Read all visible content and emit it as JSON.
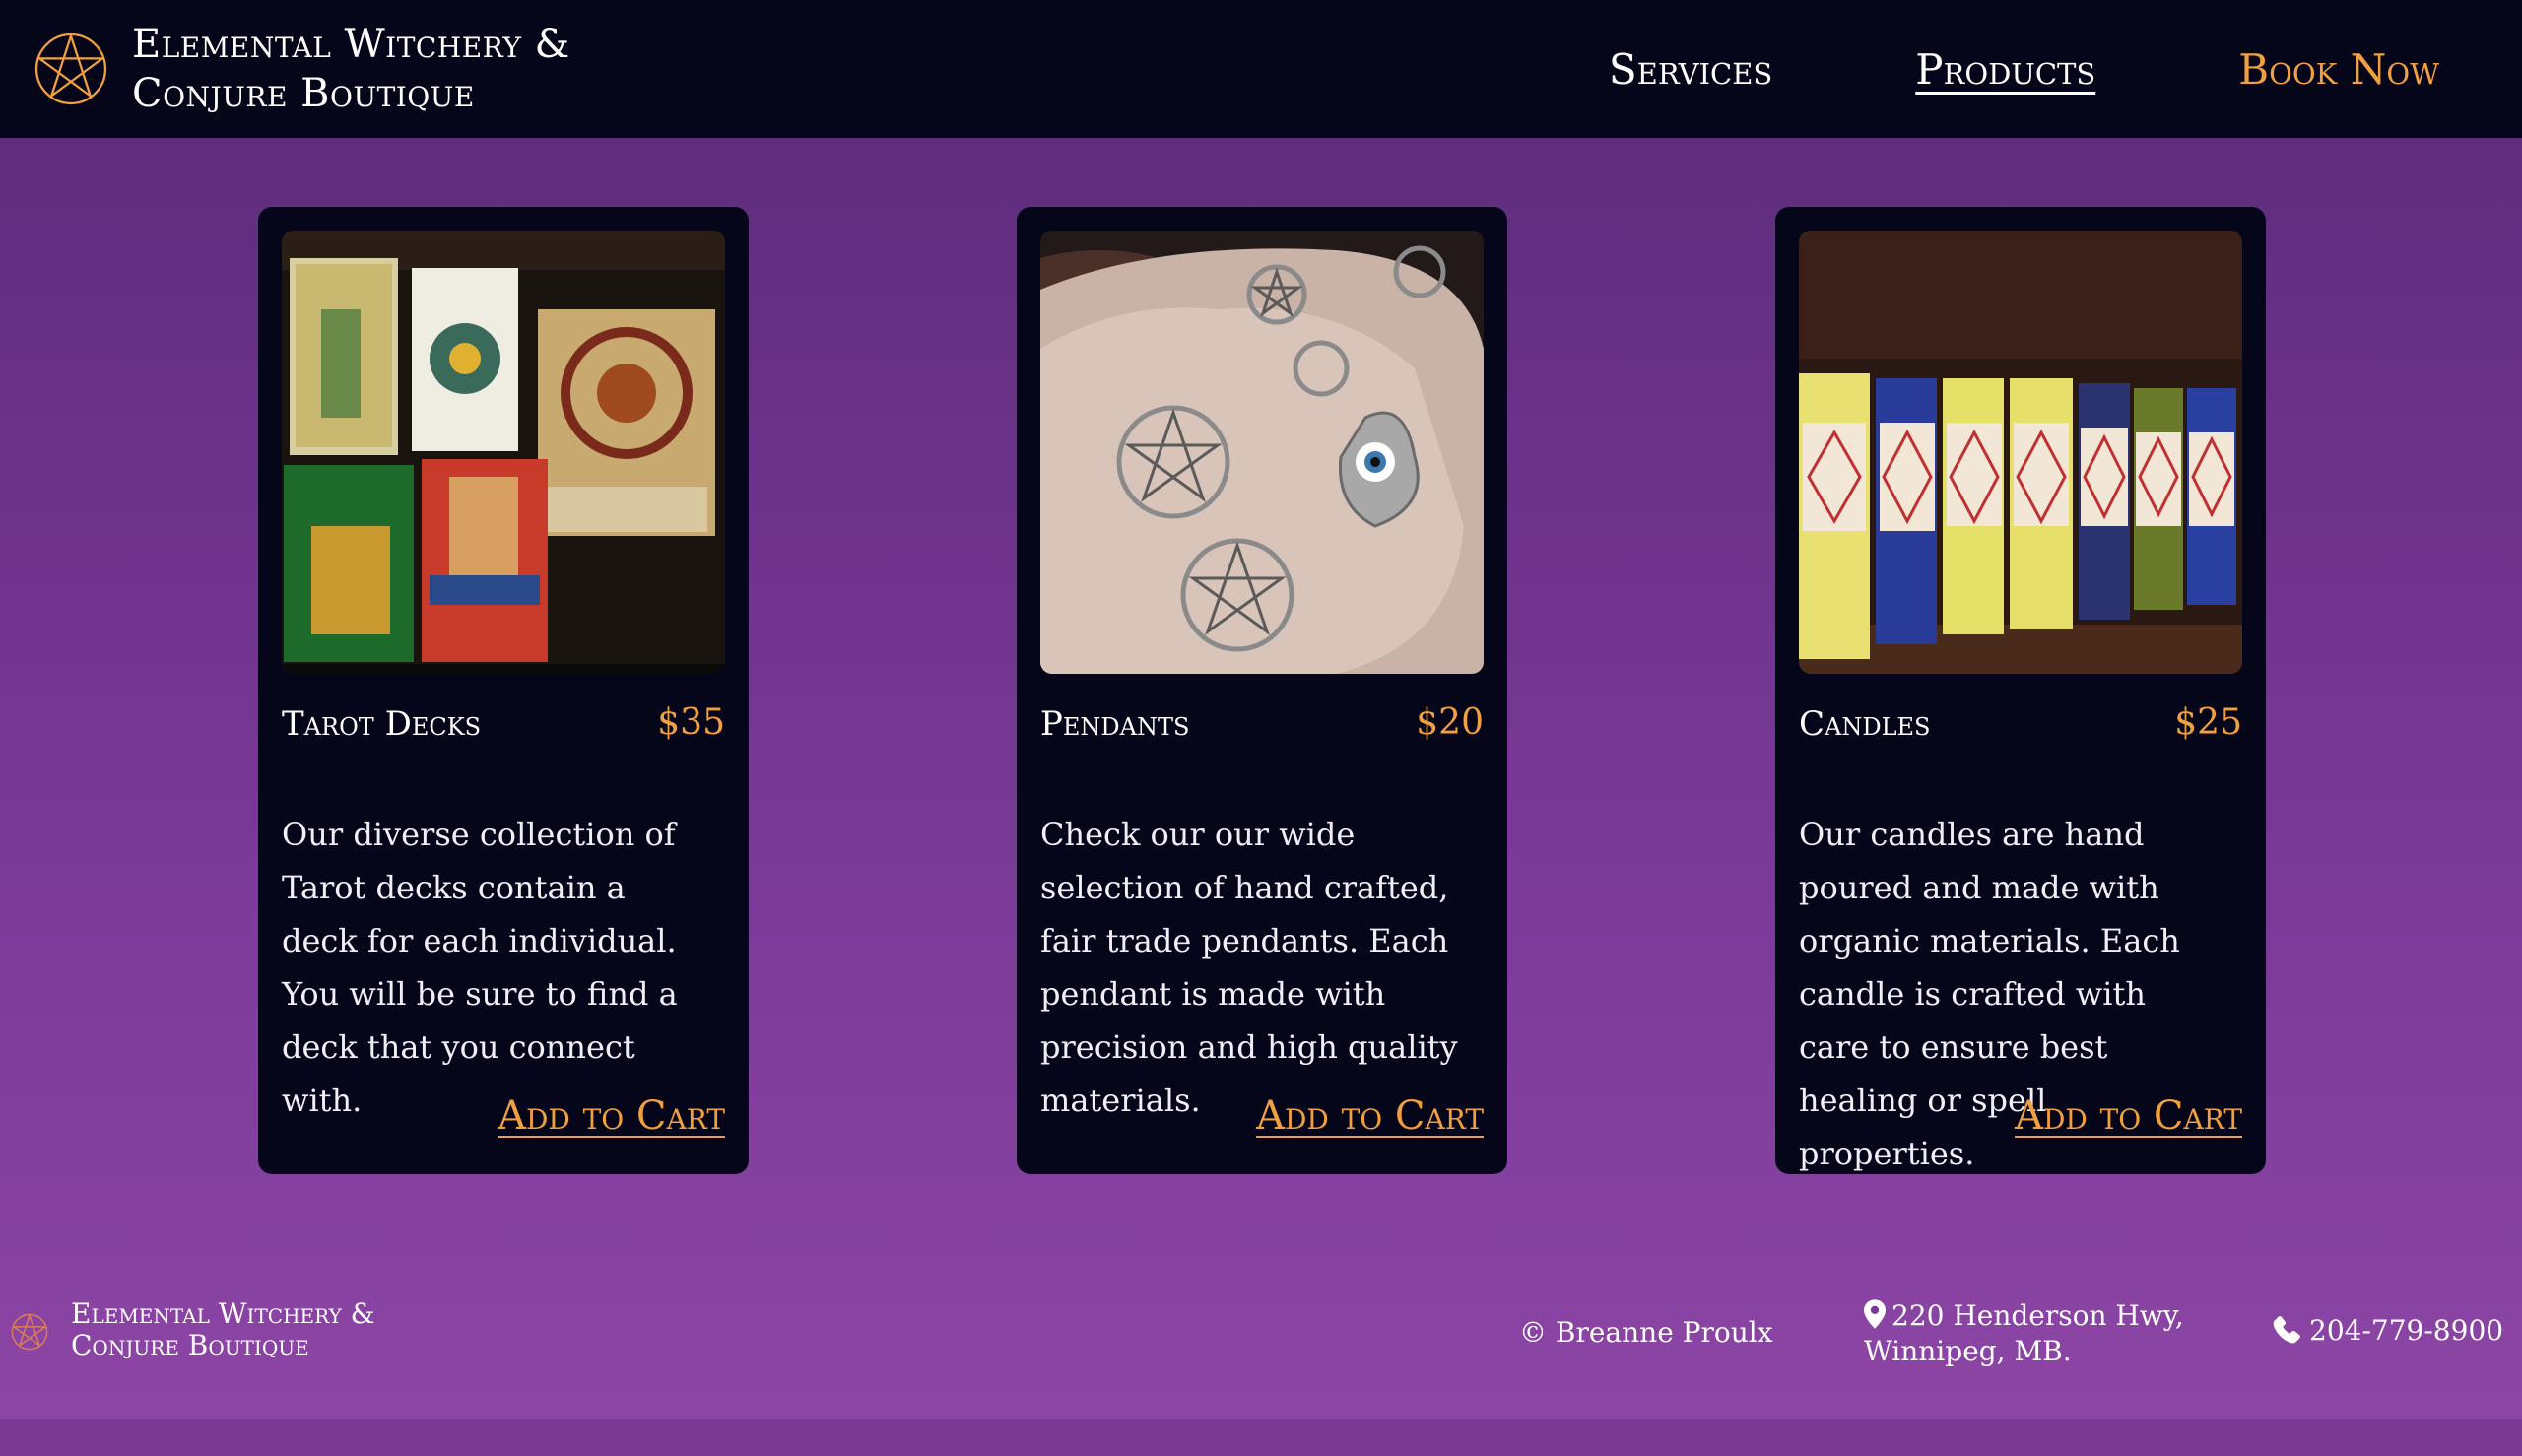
{
  "header": {
    "brand_line1": "Elemental Witchery &",
    "brand_line2": "Conjure Boutique",
    "logo_icon": "pentagram-icon",
    "nav": [
      {
        "label": "Services"
      },
      {
        "label": "Products",
        "active": true
      },
      {
        "label": "Book Now",
        "cta": true
      }
    ]
  },
  "products": [
    {
      "title": "Tarot Decks",
      "price": "$35",
      "description": "Our diverse collection of Tarot decks contain a deck for each individual. You will be sure to find a deck that you connect with.",
      "button": "Add to Cart",
      "image_icon": "tarot-decks-photo"
    },
    {
      "title": "Pendants",
      "price": "$20",
      "description": "Check our our wide selection of hand crafted, fair trade pendants. Each pendant is made with precision and high quality materials.",
      "button": "Add to Cart",
      "image_icon": "pendants-photo"
    },
    {
      "title": "Candles",
      "price": "$25",
      "description": "Our candles are hand poured and made with organic materials. Each candle is crafted with care to ensure best healing or spell properties.",
      "button": "Add to Cart",
      "image_icon": "candles-photo"
    }
  ],
  "footer": {
    "brand_line1": "Elemental Witchery &",
    "brand_line2": "Conjure Boutique",
    "copyright": "© Breanne Proulx",
    "address_line1": "220 Henderson Hwy,",
    "address_line2": "Winnipeg, MB.",
    "phone": "204-779-8900",
    "address_icon": "map-pin-icon",
    "phone_icon": "phone-icon"
  },
  "colors": {
    "header_bg": "#06061a",
    "accent": "#f0a040",
    "page_bg_top": "#5a2a78",
    "page_bg_bottom": "#8e46a6"
  }
}
